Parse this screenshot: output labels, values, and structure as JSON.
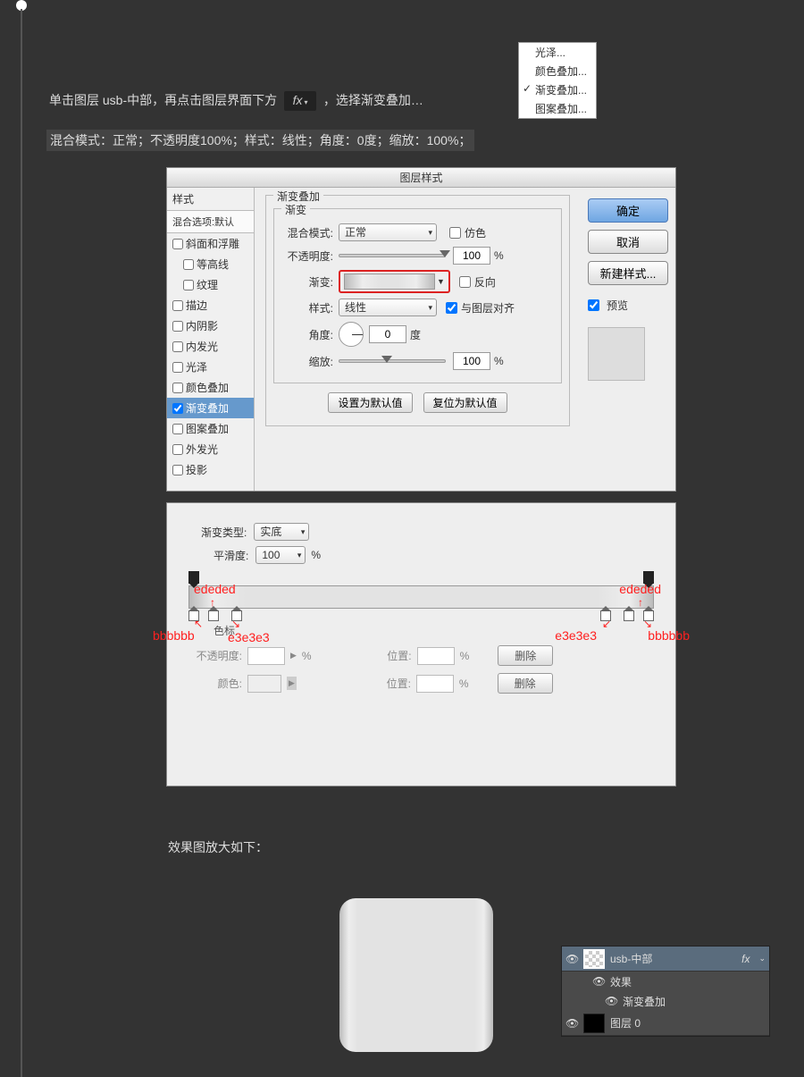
{
  "instruction": {
    "pre": "单击图层 usb-中部，再点击图层界面下方",
    "fx": "fx",
    "post": "，选择渐变叠加…"
  },
  "summary": "混合模式：正常；不透明度100%；样式：线性；角度：0度；缩放：100%；",
  "context_menu": {
    "items": [
      "光泽...",
      "颜色叠加...",
      "渐变叠加...",
      "图案叠加..."
    ],
    "checked_index": 2
  },
  "layer_style": {
    "dialog_title": "图层样式",
    "sidebar_header": "样式",
    "blend_options": "混合选项:默认",
    "items": [
      {
        "label": "斜面和浮雕",
        "indent": false
      },
      {
        "label": "等高线",
        "indent": true
      },
      {
        "label": "纹理",
        "indent": true
      },
      {
        "label": "描边",
        "indent": false
      },
      {
        "label": "内阴影",
        "indent": false
      },
      {
        "label": "内发光",
        "indent": false
      },
      {
        "label": "光泽",
        "indent": false
      },
      {
        "label": "颜色叠加",
        "indent": false
      },
      {
        "label": "渐变叠加",
        "indent": false,
        "selected": true,
        "checked": true
      },
      {
        "label": "图案叠加",
        "indent": false
      },
      {
        "label": "外发光",
        "indent": false
      },
      {
        "label": "投影",
        "indent": false
      }
    ],
    "section_title": "渐变叠加",
    "gradient_legend": "渐变",
    "blend_mode_label": "混合模式:",
    "blend_mode_value": "正常",
    "dither_label": "仿色",
    "opacity_label": "不透明度:",
    "opacity_value": "100",
    "pct": "%",
    "gradient_label": "渐变:",
    "reverse_label": "反向",
    "style_label": "样式:",
    "style_value": "线性",
    "align_label": "与图层对齐",
    "angle_label": "角度:",
    "angle_value": "0",
    "degree": "度",
    "scale_label": "缩放:",
    "scale_value": "100",
    "make_default": "设置为默认值",
    "reset_default": "复位为默认值",
    "ok": "确定",
    "cancel": "取消",
    "new_style": "新建样式...",
    "preview": "预览"
  },
  "gradient_editor": {
    "type_label": "渐变类型:",
    "type_value": "实底",
    "smooth_label": "平滑度:",
    "smooth_value": "100",
    "pct": "%",
    "stops_legend": "色标",
    "opacity_label": "不透明度:",
    "location_label": "位置:",
    "color_label": "颜色:",
    "delete": "删除",
    "colors": {
      "outer": "bbbbbb",
      "mid": "ededed",
      "inner": "e3e3e3"
    }
  },
  "result_label": "效果图放大如下：",
  "layers": {
    "layer1": "usb-中部",
    "effects": "效果",
    "grad_overlay": "渐变叠加",
    "layer0": "图层 0",
    "fx": "fx"
  }
}
